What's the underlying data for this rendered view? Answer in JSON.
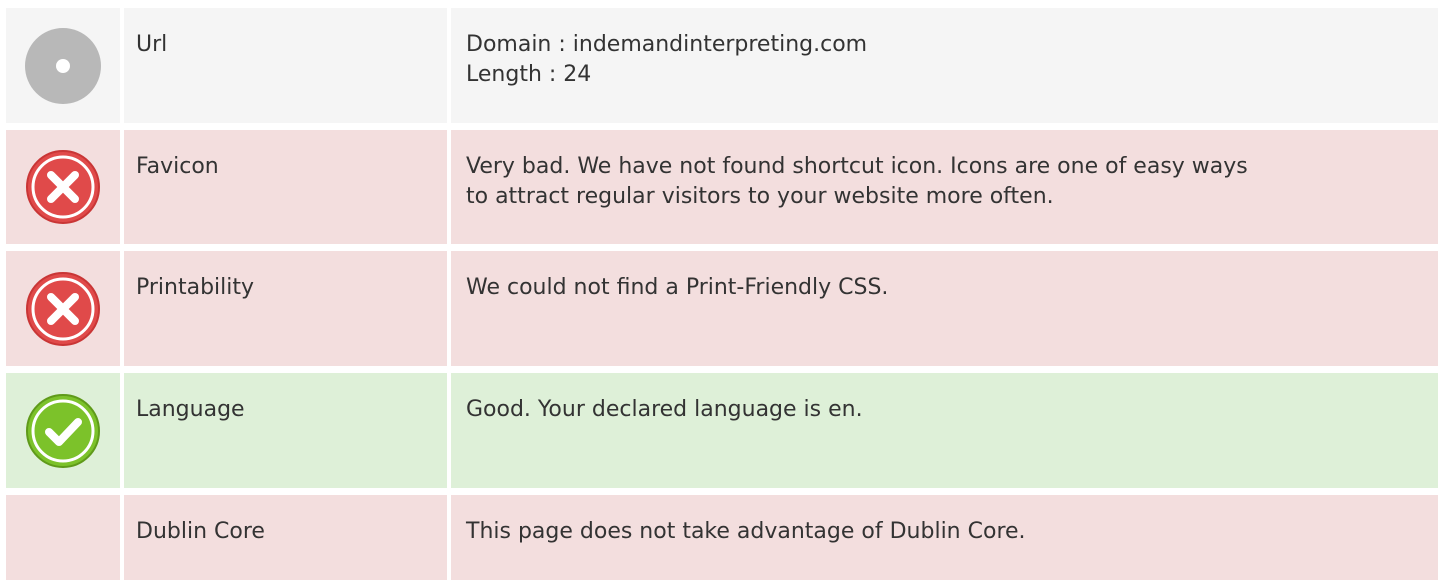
{
  "rows": [
    {
      "status": "neutral",
      "icon": "info-circle-icon",
      "label": "Url",
      "lines": [
        "Domain : indemandinterpreting.com",
        "Length : 24"
      ]
    },
    {
      "status": "bad",
      "icon": "error-x-icon",
      "label": "Favicon",
      "lines": [
        "Very bad. We have not found shortcut icon. Icons are one of easy ways",
        "to attract regular visitors to your website more often."
      ]
    },
    {
      "status": "bad",
      "icon": "error-x-icon",
      "label": "Printability",
      "lines": [
        "We could not find a Print-Friendly CSS."
      ]
    },
    {
      "status": "good",
      "icon": "checkmark-icon",
      "label": "Language",
      "lines": [
        "Good. Your declared language is en."
      ]
    },
    {
      "status": "bad",
      "icon": "",
      "label": "Dublin Core",
      "lines": [
        "This page does not take advantage of Dublin Core."
      ]
    }
  ],
  "colors": {
    "neutral_bg": "#f5f5f5",
    "bad_bg": "#f3dede",
    "good_bg": "#def0d8",
    "error_red": "#e04a4a",
    "good_green": "#7cc22a",
    "neutral_gray": "#b5b5b5"
  }
}
